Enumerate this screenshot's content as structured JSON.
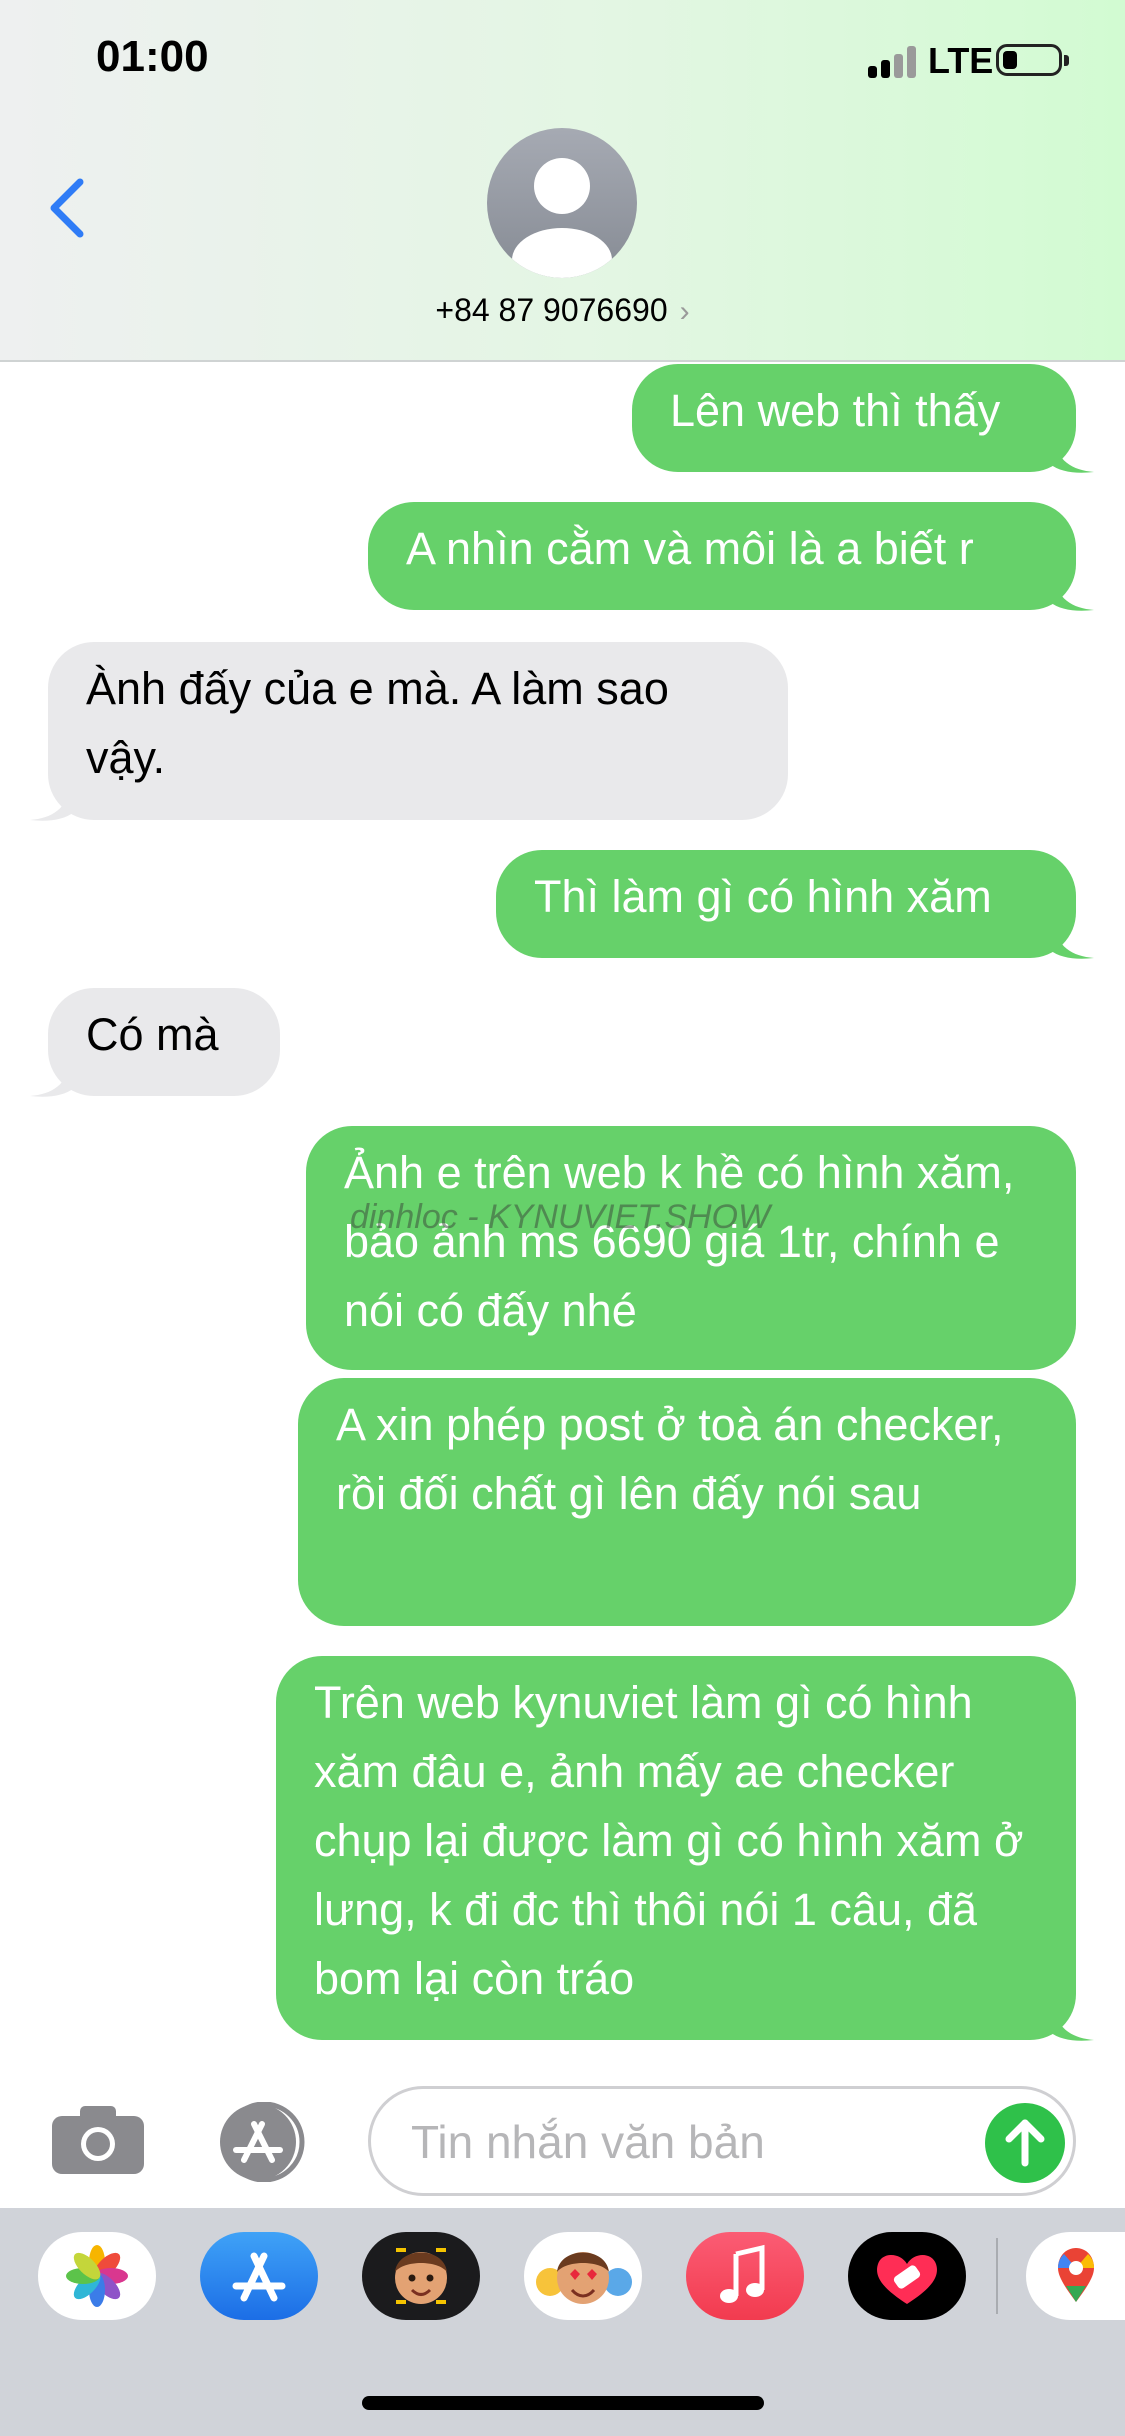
{
  "status_bar": {
    "time": "01:00",
    "network": "LTE"
  },
  "header": {
    "contact_number": "+84 87 9076690",
    "contact_chevron": "›"
  },
  "messages": [
    {
      "type": "sent",
      "text": "Lên web thì thấy"
    },
    {
      "type": "sent",
      "text": "A nhìn cằm và môi là a biết r"
    },
    {
      "type": "received",
      "text": "Ành đấy của e mà. A làm sao vậy."
    },
    {
      "type": "sent",
      "text": "Thì làm gì có hình xăm"
    },
    {
      "type": "received",
      "text": "Có mà"
    },
    {
      "type": "sent",
      "text": "Ảnh e trên web k hề có hình xăm, bảo ảnh ms 6690 giá 1tr, chính e nói có đấy nhé"
    },
    {
      "type": "sent",
      "text": "A xin phép post ở toà án checker, rồi đối chất gì lên đấy nói sau"
    },
    {
      "type": "sent",
      "text": "Trên web kynuviet làm gì có hình xăm đâu e, ảnh mấy ae checker chụp lại được làm gì có hình xăm ở lưng, k đi đc thì thôi nói 1 câu, đã bom lại còn tráo"
    }
  ],
  "watermark": "dinhloc - KYNUVIET.SHOW",
  "input": {
    "placeholder": "Tin nhắn văn bản",
    "value": ""
  },
  "colors": {
    "sent_bubble": "#66d16a",
    "received_bubble": "#e9e9eb",
    "accent": "#2f7cf6",
    "send_button": "#2fc14a"
  },
  "icons": {
    "back": "chevron-left-icon",
    "camera": "camera-icon",
    "app_store": "app-store-icon",
    "send": "arrow-up-icon"
  },
  "dock_apps": [
    "photos-icon",
    "app-store-icon",
    "memoji-icon",
    "memoji-stickers-icon",
    "music-icon",
    "fitness-heart-icon",
    "maps-icon"
  ]
}
